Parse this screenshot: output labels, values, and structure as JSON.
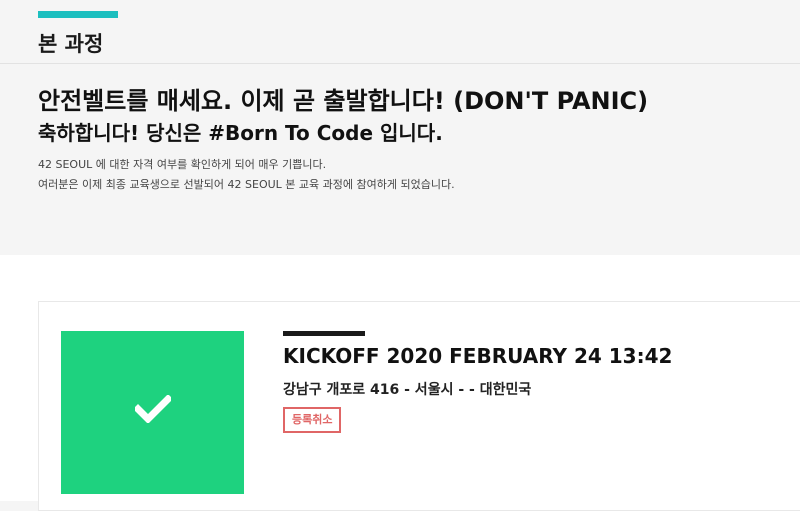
{
  "section": {
    "title": "본 과정"
  },
  "announcement": {
    "headline_1": "안전벨트를 매세요. 이제 곧 출발합니다! (DON'T PANIC)",
    "headline_2": "축하합니다! 당신은 #Born To Code 입니다.",
    "body_1": "42 SEOUL 에 대한 자격 여부를 확인하게 되어 매우 기쁩니다.",
    "body_2": "여러분은 이제 최종 교육생으로 선발되어 42 SEOUL 본 교육 과정에 참여하게 되었습니다."
  },
  "event": {
    "title": "KICKOFF 2020 FEBRUARY 24 13:42",
    "location": "강남구 개포로 416 - 서울시 - - 대한민국",
    "cancel_label": "등록취소",
    "status_icon": "check-icon"
  },
  "colors": {
    "accent": "#1cbfbf",
    "status_green": "#1ed27f",
    "cancel_red": "#e06666"
  }
}
